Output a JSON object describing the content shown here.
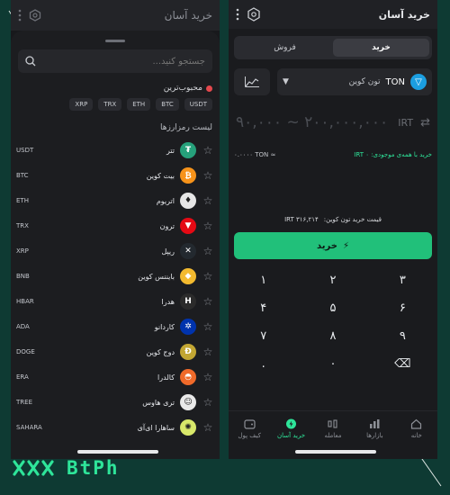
{
  "brand": {
    "text": "BtPh",
    "accent": "#2ee59a",
    "logo_icon": "double-x-logo-icon"
  },
  "left": {
    "header_title": "خرید آسان",
    "search_placeholder": "جستجو کنید...",
    "favorites_title": "محبوب‌ترین",
    "chips": [
      "USDT",
      "BTC",
      "ETH",
      "TRX",
      "XRP"
    ],
    "list_title": "لیست رمزارزها",
    "coins": [
      {
        "name": "تتر",
        "symbol": "USDT",
        "color": "#26a17b",
        "glyph": "₮"
      },
      {
        "name": "بیت کوین",
        "symbol": "BTC",
        "color": "#f7931a",
        "glyph": "₿"
      },
      {
        "name": "اتریوم",
        "symbol": "ETH",
        "color": "#e6e6e6",
        "glyph": "♦"
      },
      {
        "name": "ترون",
        "symbol": "TRX",
        "color": "#e50914",
        "glyph": "▼"
      },
      {
        "name": "ریپل",
        "symbol": "XRP",
        "color": "#23292f",
        "glyph": "✕"
      },
      {
        "name": "بایننس کوین",
        "symbol": "BNB",
        "color": "#f3ba2f",
        "glyph": "◆"
      },
      {
        "name": "هدرا",
        "symbol": "HBAR",
        "color": "#2b2b2b",
        "glyph": "H"
      },
      {
        "name": "کاردانو",
        "symbol": "ADA",
        "color": "#0033ad",
        "glyph": "✲"
      },
      {
        "name": "دوج کوین",
        "symbol": "DOGE",
        "color": "#c2a633",
        "glyph": "Ð"
      },
      {
        "name": "کالدرا",
        "symbol": "ERA",
        "color": "#f06a2a",
        "glyph": "◓"
      },
      {
        "name": "تری هاوس",
        "symbol": "TREE",
        "color": "#e9e9e9",
        "glyph": "☺"
      },
      {
        "name": "ساهارا ای‌آی",
        "symbol": "SAHARA",
        "color": "#d8e86a",
        "glyph": "✺"
      }
    ]
  },
  "right": {
    "header_title": "خرید آسان",
    "tabs": {
      "buy": "خرید",
      "sell": "فروش"
    },
    "asset_symbol": "TON",
    "asset_name": "تون کوین",
    "amount_placeholder": "۹۰,۰۰۰ ~ ۲۰۰,۰۰۰,۰۰۰",
    "amount_currency": "IRT",
    "buy_all_text": "خرید با همه‌ی موجودی: IRT ۰",
    "balance_text": "۰.۰۰۰۰ TON ≈",
    "price_label": "قیمت خرید تون کوین:",
    "price_value": "۳۱۶,۲۱۴ IRT",
    "buy_button": "خرید",
    "keys": [
      "۳",
      "۲",
      "۱",
      "۶",
      "۵",
      "۴",
      "۹",
      "۸",
      "۷",
      "⌫",
      "۰",
      "."
    ],
    "nav": [
      {
        "label": "خانه",
        "icon": "home-icon",
        "active": false
      },
      {
        "label": "بازارها",
        "icon": "markets-icon",
        "active": false
      },
      {
        "label": "معامله",
        "icon": "trade-icon",
        "active": false
      },
      {
        "label": "خرید آسان",
        "icon": "easy-buy-icon",
        "active": true
      },
      {
        "label": "کیف پول",
        "icon": "wallet-icon",
        "active": false
      }
    ]
  }
}
